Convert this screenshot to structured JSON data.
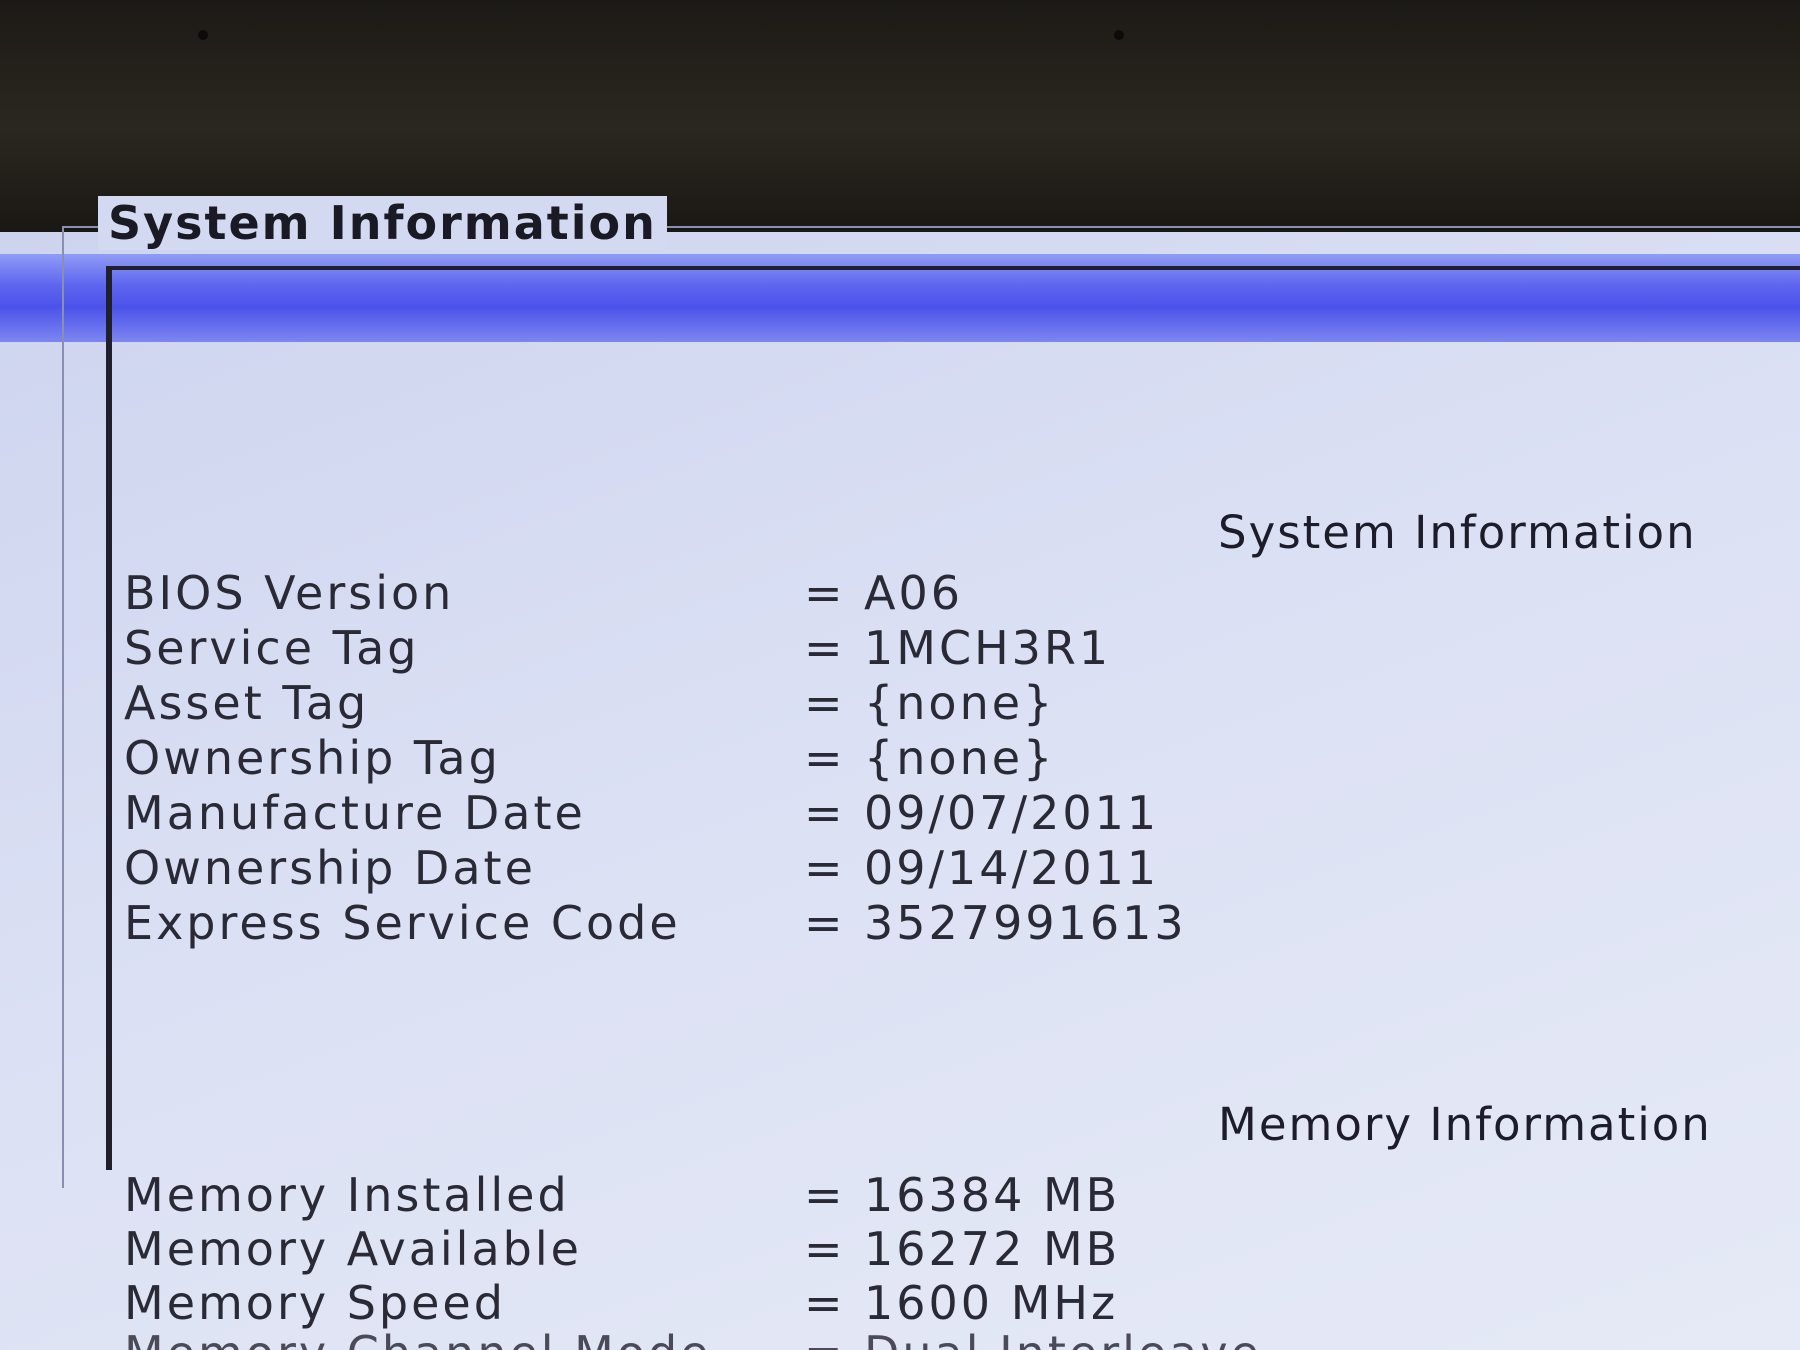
{
  "group_title": "System Information",
  "system_section": {
    "header": "System Information",
    "rows": [
      {
        "label": "BIOS Version",
        "value": "A06"
      },
      {
        "label": "Service Tag",
        "value": "1MCH3R1"
      },
      {
        "label": "Asset Tag",
        "value": "{none}"
      },
      {
        "label": "Ownership Tag",
        "value": "{none}"
      },
      {
        "label": "Manufacture Date",
        "value": "09/07/2011"
      },
      {
        "label": "Ownership Date",
        "value": "09/14/2011"
      },
      {
        "label": "Express Service Code",
        "value": "3527991613"
      }
    ]
  },
  "memory_section": {
    "header": "Memory Information",
    "rows": [
      {
        "label": "Memory Installed",
        "value": "16384 MB"
      },
      {
        "label": "Memory Available",
        "value": "16272 MB"
      },
      {
        "label": "Memory Speed",
        "value": "1600 MHz"
      },
      {
        "label": "Memory Channel Mode",
        "value": "Dual Interleave"
      }
    ]
  },
  "separator": "="
}
